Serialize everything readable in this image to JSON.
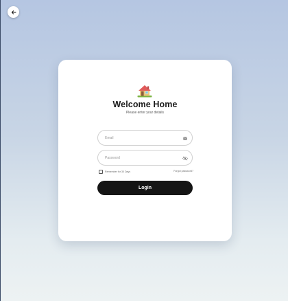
{
  "header": {
    "back_icon": "arrow-left-icon"
  },
  "card": {
    "logo_icon": "house-icon",
    "title": "Welcome Home",
    "subtitle": "Please enter your details"
  },
  "form": {
    "email": {
      "placeholder": "Email",
      "value": "",
      "icon": "envelope-icon"
    },
    "password": {
      "placeholder": "Password",
      "value": "",
      "icon": "eye-off-icon"
    },
    "remember_label": "Remember for 30 Days",
    "forgot_label": "Forgot password?",
    "login_label": "Login"
  },
  "colors": {
    "button_bg": "#151515",
    "card_bg": "#ffffff",
    "house_roof": "#e05a5a",
    "house_wall": "#e8c27a",
    "house_grass": "#7cb342"
  }
}
